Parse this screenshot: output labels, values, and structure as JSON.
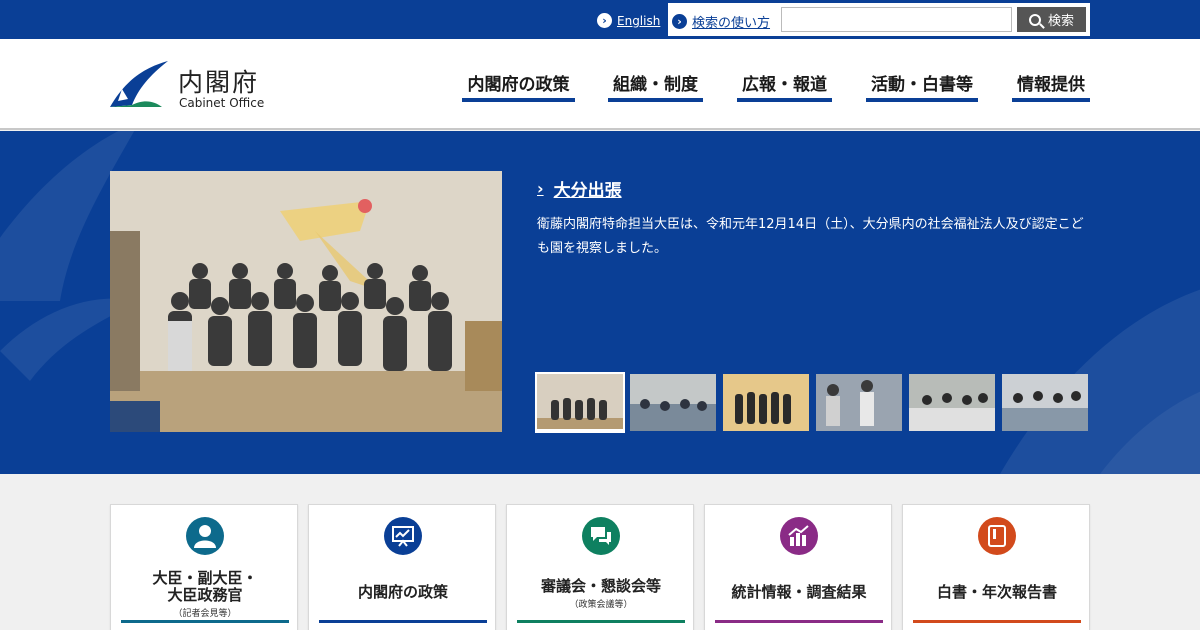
{
  "topbar": {
    "english_label": "English",
    "search_help_label": "検索の使い方",
    "search_placeholder": "",
    "search_button_label": "検索"
  },
  "header": {
    "logo_jp": "内閣府",
    "logo_en": "Cabinet Office",
    "nav": [
      {
        "label": "内閣府の政策"
      },
      {
        "label": "組織・制度"
      },
      {
        "label": "広報・報道"
      },
      {
        "label": "活動・白書等"
      },
      {
        "label": "情報提供"
      }
    ]
  },
  "hero": {
    "title": "大分出張",
    "description": "衛藤内閣府特命担当大臣は、令和元年12月14日（土）、大分県内の社会福祉法人及び認定こども園を視察しました。",
    "thumbnail_count": 6,
    "active_thumbnail": 1
  },
  "cards": [
    {
      "title_line1": "大臣・副大臣・",
      "title_line2": "大臣政務官",
      "sub": "（記者会見等）",
      "icon": "person-icon",
      "color": "#0d6a8c"
    },
    {
      "title_line1": "内閣府の政策",
      "title_line2": "",
      "sub": "",
      "icon": "presentation-icon",
      "color": "#0a3f96"
    },
    {
      "title_line1": "審議会・懇談会等",
      "title_line2": "",
      "sub": "（政策会議等）",
      "icon": "chat-icon",
      "color": "#0e8060"
    },
    {
      "title_line1": "統計情報・調査結果",
      "title_line2": "",
      "sub": "",
      "icon": "chart-icon",
      "color": "#8a2b86"
    },
    {
      "title_line1": "白書・年次報告書",
      "title_line2": "",
      "sub": "",
      "icon": "book-icon",
      "color": "#d24a1c"
    }
  ],
  "colors": {
    "brand_blue": "#0a3f96",
    "logo_green": "#1c8a5c"
  }
}
